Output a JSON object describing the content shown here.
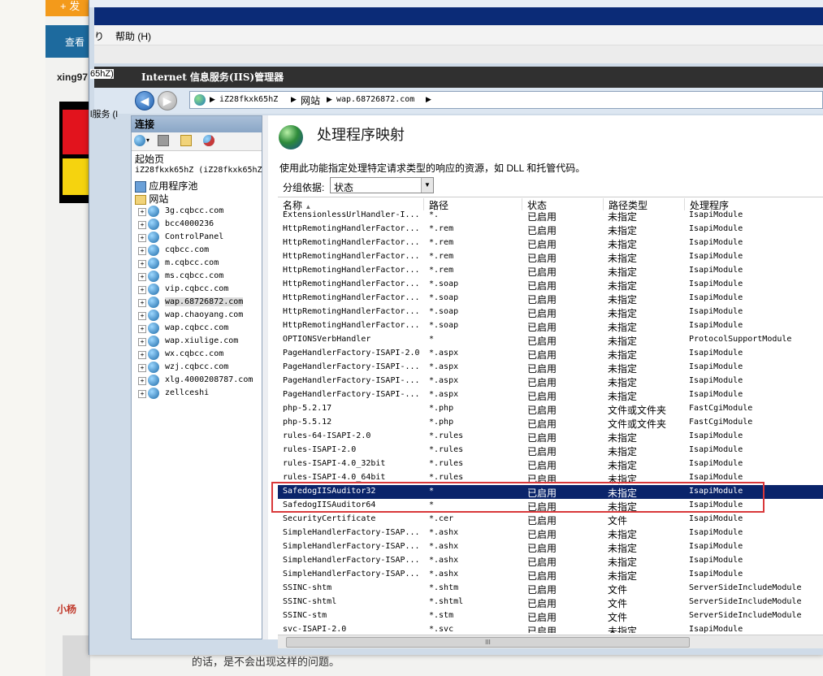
{
  "background_page": {
    "add_button": "+ 发",
    "view_button": "查看",
    "username": "xing97",
    "username2": "小杨",
    "bottom_text": "的话，是不会出现这样的问题。"
  },
  "behind_window": {
    "label1": "65hZ)",
    "label2": "l服务 (I"
  },
  "menubar": {
    "items": [
      "り",
      "帮助 (H)"
    ]
  },
  "iis": {
    "title": "Internet 信息服务(IIS)管理器"
  },
  "address": {
    "crumbs": [
      "iZ28fkxk65hZ",
      "网站",
      "wap.68726872.com"
    ]
  },
  "connections": {
    "header": "连接",
    "tree": {
      "start_page": "起始页",
      "server": "iZ28fkxk65hZ (iZ28fkxk65hZ",
      "app_pools": "应用程序池",
      "sites": "网站",
      "site_list": [
        "3g.cqbcc.com",
        "bcc4000236",
        "ControlPanel",
        "cqbcc.com",
        "m.cqbcc.com",
        "ms.cqbcc.com",
        "vip.cqbcc.com",
        "wap.68726872.com",
        "wap.chaoyang.com",
        "wap.cqbcc.com",
        "wap.xiulige.com",
        "wx.cqbcc.com",
        "wzj.cqbcc.com",
        "xlg.4000208787.com",
        "zellceshi"
      ],
      "selected": "wap.68726872.com"
    }
  },
  "main": {
    "title": "处理程序映射",
    "description": "使用此功能指定处理特定请求类型的响应的资源，如 DLL 和托管代码。",
    "group_by_label": "分组依据:",
    "group_by_value": "状态",
    "columns": [
      "名称",
      "路径",
      "状态",
      "路径类型",
      "处理程序"
    ],
    "rows": [
      [
        "ExtensionlessUrlHandler-I...",
        "*.",
        "已启用",
        "未指定",
        "IsapiModule"
      ],
      [
        "HttpRemotingHandlerFactor...",
        "*.rem",
        "已启用",
        "未指定",
        "IsapiModule"
      ],
      [
        "HttpRemotingHandlerFactor...",
        "*.rem",
        "已启用",
        "未指定",
        "IsapiModule"
      ],
      [
        "HttpRemotingHandlerFactor...",
        "*.rem",
        "已启用",
        "未指定",
        "IsapiModule"
      ],
      [
        "HttpRemotingHandlerFactor...",
        "*.rem",
        "已启用",
        "未指定",
        "IsapiModule"
      ],
      [
        "HttpRemotingHandlerFactor...",
        "*.soap",
        "已启用",
        "未指定",
        "IsapiModule"
      ],
      [
        "HttpRemotingHandlerFactor...",
        "*.soap",
        "已启用",
        "未指定",
        "IsapiModule"
      ],
      [
        "HttpRemotingHandlerFactor...",
        "*.soap",
        "已启用",
        "未指定",
        "IsapiModule"
      ],
      [
        "HttpRemotingHandlerFactor...",
        "*.soap",
        "已启用",
        "未指定",
        "IsapiModule"
      ],
      [
        "OPTIONSVerbHandler",
        "*",
        "已启用",
        "未指定",
        "ProtocolSupportModule"
      ],
      [
        "PageHandlerFactory-ISAPI-2.0",
        "*.aspx",
        "已启用",
        "未指定",
        "IsapiModule"
      ],
      [
        "PageHandlerFactory-ISAPI-...",
        "*.aspx",
        "已启用",
        "未指定",
        "IsapiModule"
      ],
      [
        "PageHandlerFactory-ISAPI-...",
        "*.aspx",
        "已启用",
        "未指定",
        "IsapiModule"
      ],
      [
        "PageHandlerFactory-ISAPI-...",
        "*.aspx",
        "已启用",
        "未指定",
        "IsapiModule"
      ],
      [
        "php-5.2.17",
        "*.php",
        "已启用",
        "文件或文件夹",
        "FastCgiModule"
      ],
      [
        "php-5.5.12",
        "*.php",
        "已启用",
        "文件或文件夹",
        "FastCgiModule"
      ],
      [
        "rules-64-ISAPI-2.0",
        "*.rules",
        "已启用",
        "未指定",
        "IsapiModule"
      ],
      [
        "rules-ISAPI-2.0",
        "*.rules",
        "已启用",
        "未指定",
        "IsapiModule"
      ],
      [
        "rules-ISAPI-4.0_32bit",
        "*.rules",
        "已启用",
        "未指定",
        "IsapiModule"
      ],
      [
        "rules-ISAPI-4.0_64bit",
        "*.rules",
        "已启用",
        "未指定",
        "IsapiModule"
      ],
      [
        "SafedogIISAuditor32",
        "*",
        "已启用",
        "未指定",
        "IsapiModule"
      ],
      [
        "SafedogIISAuditor64",
        "*",
        "已启用",
        "未指定",
        "IsapiModule"
      ],
      [
        "SecurityCertificate",
        "*.cer",
        "已启用",
        "文件",
        "IsapiModule"
      ],
      [
        "SimpleHandlerFactory-ISAP...",
        "*.ashx",
        "已启用",
        "未指定",
        "IsapiModule"
      ],
      [
        "SimpleHandlerFactory-ISAP...",
        "*.ashx",
        "已启用",
        "未指定",
        "IsapiModule"
      ],
      [
        "SimpleHandlerFactory-ISAP...",
        "*.ashx",
        "已启用",
        "未指定",
        "IsapiModule"
      ],
      [
        "SimpleHandlerFactory-ISAP...",
        "*.ashx",
        "已启用",
        "未指定",
        "IsapiModule"
      ],
      [
        "SSINC-shtm",
        "*.shtm",
        "已启用",
        "文件",
        "ServerSideIncludeModule"
      ],
      [
        "SSINC-shtml",
        "*.shtml",
        "已启用",
        "文件",
        "ServerSideIncludeModule"
      ],
      [
        "SSINC-stm",
        "*.stm",
        "已启用",
        "文件",
        "ServerSideIncludeModule"
      ],
      [
        "svc-ISAPI-2.0",
        "*.svc",
        "已启用",
        "未指定",
        "IsapiModule"
      ]
    ],
    "highlighted_row": "SafedogIISAuditor32",
    "scroll_thumb": "III"
  },
  "colors": {
    "selection": "#0a246a",
    "annotation_box": "#d9383a",
    "iis_titlebar": "#303030"
  }
}
